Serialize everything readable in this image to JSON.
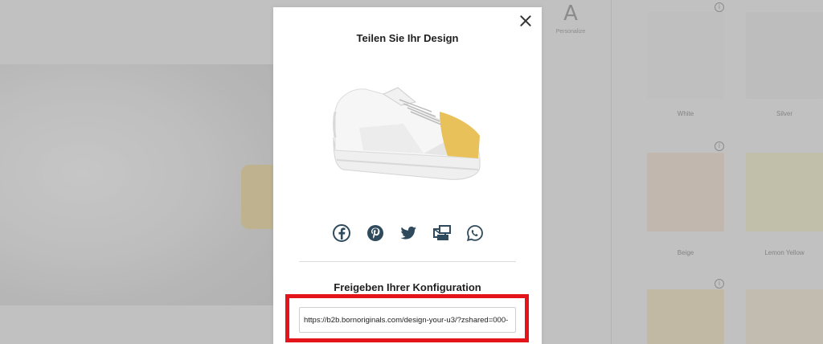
{
  "background": {
    "tool_glyph": "A",
    "tool_label": "Personalize",
    "swatches": [
      {
        "label": "White",
        "color": "#f3f3f3"
      },
      {
        "label": "Silver",
        "color": "#f0f0f0"
      },
      {
        "label": "Beige",
        "color": "#f7e6d7"
      },
      {
        "label": "Lemon Yellow",
        "color": "#f7f2cf"
      },
      {
        "label": "",
        "color": "#f8e9c5"
      },
      {
        "label": "",
        "color": "#f7ecd9"
      }
    ]
  },
  "modal": {
    "title": "Teilen Sie Ihr Design",
    "share_icons": [
      "facebook-icon",
      "pinterest-icon",
      "twitter-icon",
      "email-icon",
      "whatsapp-icon"
    ],
    "config_title": "Freigeben Ihrer Konfiguration",
    "share_url": "https://b2b.bornoriginals.com/design-your-u3/?zshared=000-"
  },
  "colors": {
    "accent_yellow": "#e8c15a",
    "highlight_red": "#e4141b",
    "icon_color": "#2f4a5c"
  }
}
